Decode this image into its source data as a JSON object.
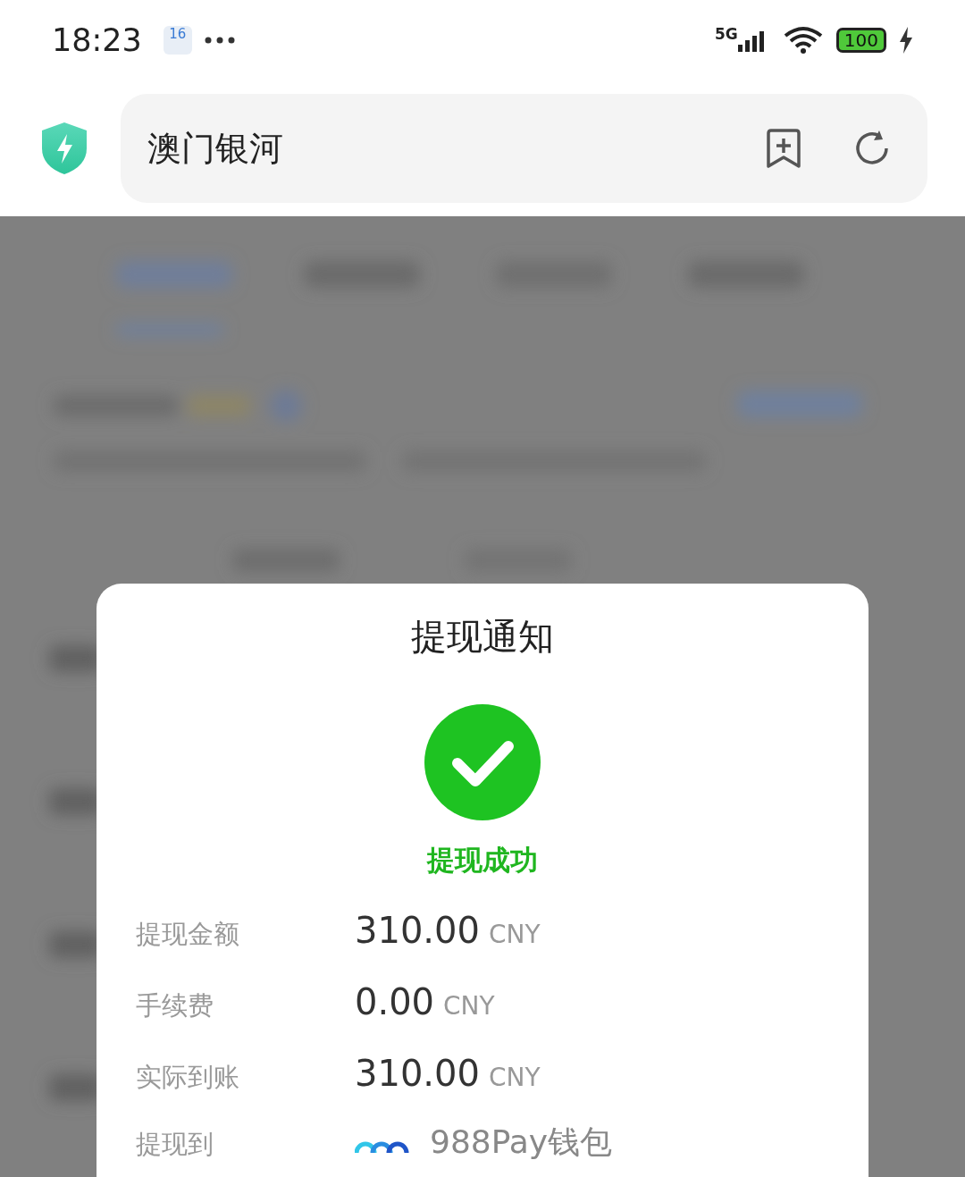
{
  "status_bar": {
    "time": "18:23",
    "calendar_day": "16",
    "network": "5G",
    "battery": "100",
    "charging": true
  },
  "address_bar": {
    "title": "澳门银河"
  },
  "dialog": {
    "title": "提现通知",
    "status": "提现成功",
    "rows": [
      {
        "kind": "amount",
        "label": "提现金额",
        "value": "310.00",
        "currency": "CNY"
      },
      {
        "kind": "amount",
        "label": "手续费",
        "value": "0.00",
        "currency": "CNY"
      },
      {
        "kind": "amount",
        "label": "实际到账",
        "value": "310.00",
        "currency": "CNY"
      },
      {
        "kind": "wallet",
        "label": "提现到",
        "value": "988Pay钱包"
      }
    ]
  }
}
